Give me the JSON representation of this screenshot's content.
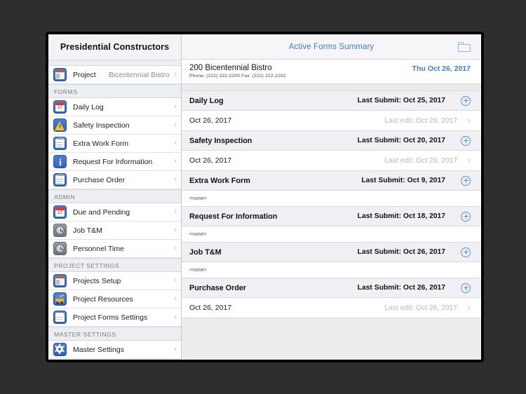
{
  "sidebar": {
    "title": "Presidential Constructors",
    "project_row": {
      "label": "Project",
      "value": "Bicentennial Bistro",
      "icon": "project-board-icon",
      "chevron": "›"
    },
    "sections": [
      {
        "header": "FORMS",
        "items": [
          {
            "label": "Daily Log",
            "icon": "calendar-icon"
          },
          {
            "label": "Safety Inspection",
            "icon": "warning-triangle-icon"
          },
          {
            "label": "Extra Work Form",
            "icon": "clipboard-icon"
          },
          {
            "label": "Request For Information",
            "icon": "info-circle-icon"
          },
          {
            "label": "Purchase Order",
            "icon": "clipboard-icon"
          }
        ]
      },
      {
        "header": "ADMIN",
        "items": [
          {
            "label": "Due and Pending",
            "icon": "calendar-icon"
          },
          {
            "label": "Job T&M",
            "icon": "clock-icon"
          },
          {
            "label": "Personnel Time",
            "icon": "clock-icon"
          }
        ]
      },
      {
        "header": "PROJECT SETTINGS",
        "items": [
          {
            "label": "Projects Setup",
            "icon": "project-board-icon"
          },
          {
            "label": "Project Resources",
            "icon": "excavator-icon"
          },
          {
            "label": "Project Forms Settings",
            "icon": "document-icon"
          }
        ]
      },
      {
        "header": "MASTER SETTINGS",
        "items": [
          {
            "label": "Master Settings",
            "icon": "gear-icon"
          }
        ]
      }
    ]
  },
  "main": {
    "topbar": {
      "title": "Active Forms Summary",
      "folder_icon": "folder-icon"
    },
    "project": {
      "name": "200 Bicentennial Bistro",
      "contact": "Phone: (222) 222-2200 Fax: (222) 222-2202",
      "date": "Thu Oct 26, 2017"
    },
    "forms": [
      {
        "title": "Daily Log",
        "last_submit": "Last Submit: Oct 25, 2017",
        "add_icon": "plus-circle-icon",
        "entry": {
          "date": "Oct 26, 2017",
          "last_edit": "Last edit: Oct 26, 2017",
          "chevron": "›",
          "empty": false
        }
      },
      {
        "title": "Safety Inspection",
        "last_submit": "Last Submit: Oct 20, 2017",
        "add_icon": "plus-circle-icon",
        "entry": {
          "date": "Oct 26, 2017",
          "last_edit": "Last edit: Oct 26, 2017",
          "chevron": "›",
          "empty": false
        }
      },
      {
        "title": "Extra Work Form",
        "last_submit": "Last Submit: Oct 9, 2017",
        "add_icon": "plus-circle-icon",
        "entry": {
          "date": "<none>",
          "last_edit": "",
          "chevron": "",
          "empty": true
        }
      },
      {
        "title": "Request For Information",
        "last_submit": "Last Submit: Oct 18, 2017",
        "add_icon": "plus-circle-icon",
        "entry": {
          "date": "<none>",
          "last_edit": "",
          "chevron": "",
          "empty": true
        }
      },
      {
        "title": "Job T&M",
        "last_submit": "Last Submit: Oct 26, 2017",
        "add_icon": "plus-circle-icon",
        "entry": {
          "date": "<none>",
          "last_edit": "",
          "chevron": "",
          "empty": true
        }
      },
      {
        "title": "Purchase Order",
        "last_submit": "Last Submit: Oct 26, 2017",
        "add_icon": "plus-circle-icon",
        "entry": {
          "date": "Oct 26, 2017",
          "last_edit": "Last edit: Oct 26, 2017",
          "chevron": "›",
          "empty": false
        }
      }
    ]
  },
  "colors": {
    "accent_blue": "#3b7ddd",
    "icon_blue": "#2f62bd",
    "row_header_gray": "#f0f0f4",
    "muted_gray": "#b8b8bd",
    "bezel": "#2e2e2e"
  }
}
